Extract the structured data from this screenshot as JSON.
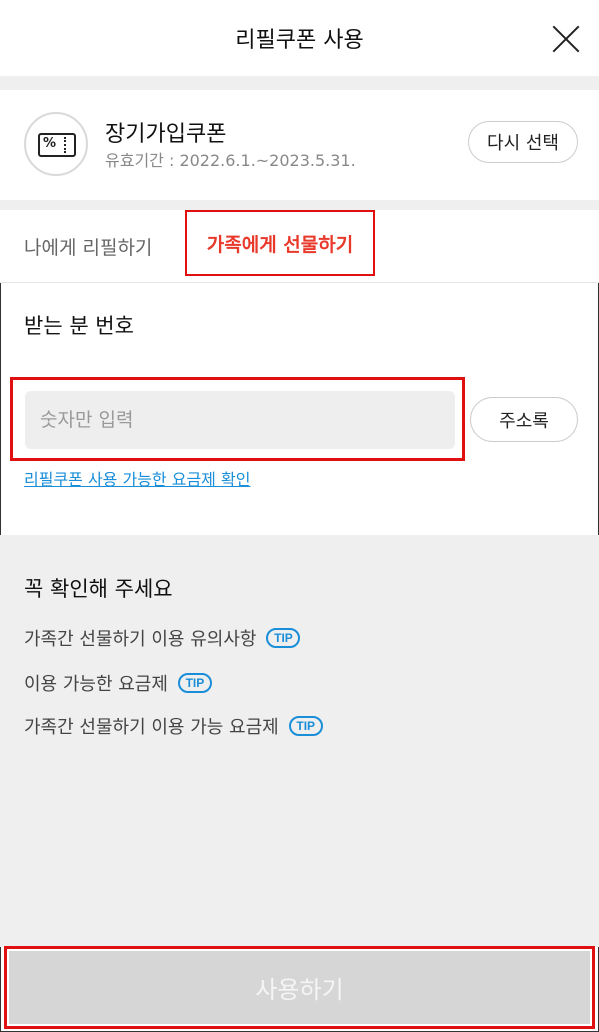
{
  "header": {
    "title": "리필쿠폰 사용"
  },
  "coupon": {
    "icon": "coupon-ticket-icon",
    "icon_text": "%",
    "name": "장기가입쿠폰",
    "period": "유효기간 : 2022.6.1.~2023.5.31.",
    "reselect_label": "다시 선택"
  },
  "tabs": [
    {
      "label": "나에게 리필하기",
      "active": false
    },
    {
      "label": "가족에게 선물하기",
      "active": true
    }
  ],
  "recipient": {
    "label": "받는 분 번호",
    "placeholder": "숫자만 입력",
    "value": "",
    "address_book_label": "주소록",
    "plan_link": "리필쿠폰 사용 가능한 요금제 확인"
  },
  "notice": {
    "title": "꼭 확인해 주세요",
    "items": [
      {
        "label": "가족간 선물하기 이용 유의사항",
        "badge": "TIP"
      },
      {
        "label": "이용 가능한 요금제",
        "badge": "TIP"
      },
      {
        "label": "가족간 선물하기 이용 가능 요금제",
        "badge": "TIP"
      }
    ]
  },
  "footer": {
    "use_label": "사용하기"
  },
  "colors": {
    "accent": "#e8392b",
    "link": "#1a8ed8",
    "highlight_border": "#e01010",
    "disabled_button": "#d6d6d6"
  }
}
